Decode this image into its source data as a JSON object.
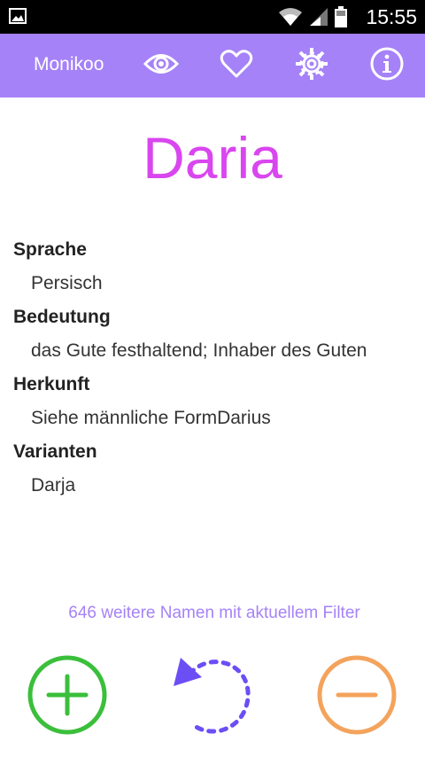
{
  "statusbar": {
    "time": "15:55",
    "icons": [
      "gallery-icon",
      "wifi-icon",
      "signal-icon",
      "battery-icon"
    ]
  },
  "appbar": {
    "title": "Monikoo",
    "color": "#a582f7",
    "actions": [
      "eye-icon",
      "heart-icon",
      "gear-icon",
      "info-icon"
    ]
  },
  "name": {
    "text": "Daria",
    "color": "#d946ef"
  },
  "details": {
    "language_label": "Sprache",
    "language_value": "Persisch",
    "meaning_label": "Bedeutung",
    "meaning_value": "das Gute festhaltend; Inhaber des Guten",
    "origin_label": "Herkunft",
    "origin_value": "Siehe männliche FormDarius",
    "variants_label": "Varianten",
    "variants_value": "Darja"
  },
  "filter_text": "646 weitere Namen mit aktuellem Filter",
  "buttons": {
    "add": {
      "icon": "plus-circle-icon",
      "color": "#3bbf3b"
    },
    "undo": {
      "icon": "undo-icon",
      "color": "#6c4ef5"
    },
    "remove": {
      "icon": "minus-circle-icon",
      "color": "#f4a35c"
    }
  }
}
